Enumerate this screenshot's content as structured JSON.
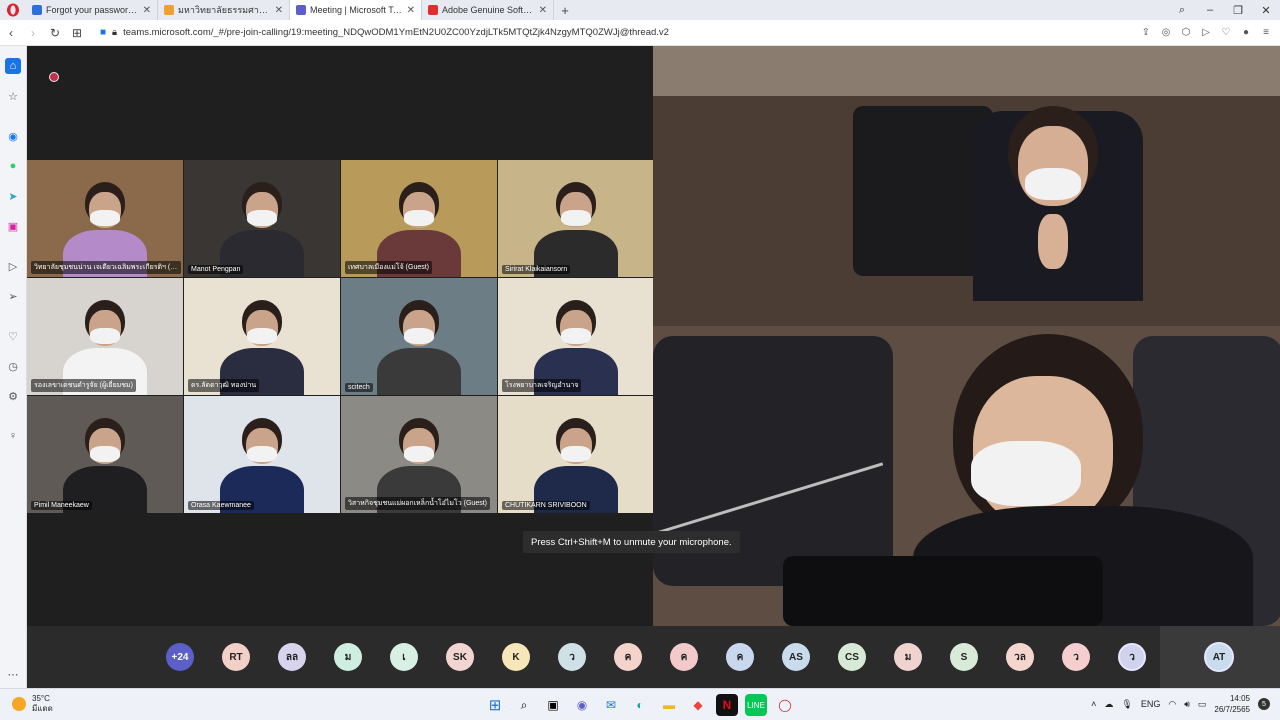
{
  "browser": {
    "tabs": [
      {
        "title": "Forgot your password? - Z",
        "color": "#2d6fdb",
        "active": false
      },
      {
        "title": "มหาวิทยาลัยธรรมศาสตร์",
        "color": "#f0a030",
        "active": false
      },
      {
        "title": "Meeting | Microsoft Tea",
        "color": "#5b5fc7",
        "active": true
      },
      {
        "title": "Adobe Genuine Software",
        "color": "#e02d2d",
        "active": false
      }
    ],
    "new_tab": "+",
    "url": "teams.microsoft.com/_#/pre-join-calling/19:meeting_NDQwODM1YmEtN2U0ZC00YzdjLTk5MTQtZjk4NzgyMTQ0ZWJj@thread.v2"
  },
  "meeting": {
    "tiles": [
      {
        "name": "วิทยาลัยชุมชนน่าน เจเดียวเฉลิมพระเกียรติฯ (Guest)",
        "bg": "#8a6a4a",
        "shirt": "#b48ac8"
      },
      {
        "name": "Manot Pengpan",
        "bg": "#3a3633",
        "shirt": "#2a2a30"
      },
      {
        "name": "เทศบาลเมืองแม่โจ้ (Guest)",
        "bg": "#b89a5a",
        "shirt": "#6a3a3a"
      },
      {
        "name": "Sirirat Klaikaiansorn",
        "bg": "#c7b489",
        "shirt": "#2b2b2b"
      },
      {
        "name": "รองเลขาเดชนดำรูจัย (ผู้เยี่ยมชม)",
        "bg": "#d7d3cf",
        "shirt": "#f3f3f3"
      },
      {
        "name": "ดร.ลัดดาวุฒิ ทองปาน",
        "bg": "#e9e2d2",
        "shirt": "#2a2c40"
      },
      {
        "name": "scitech",
        "bg": "#6c7d86",
        "shirt": "#3a3a3a"
      },
      {
        "name": "โรงพยาบาลเจริญอำนาจ",
        "bg": "#e8e0d0",
        "shirt": "#2a3050"
      },
      {
        "name": "Pimil Maneekaew",
        "bg": "#5f5a55",
        "shirt": "#1f1f22"
      },
      {
        "name": "Orasa Kaewmanee",
        "bg": "#dfe3ea",
        "shirt": "#1c2a5a"
      },
      {
        "name": "วิสาหกิจชุมชนแม่ผอกเหล็กน้ำโอ๋ไมโว (Guest)",
        "bg": "#8c8a85",
        "shirt": "#3a3a3a"
      },
      {
        "name": "CHUTIKARN SRIVIBOON",
        "bg": "#e6ddc8",
        "shirt": "#1f2a4a"
      }
    ],
    "toast": "Press Ctrl+Shift+M to unmute your microphone.",
    "participants": [
      {
        "initials": "+24",
        "color": "#5b5fc7"
      },
      {
        "initials": "RT",
        "color": "#f2cfc7"
      },
      {
        "initials": "ลล",
        "color": "#d8d4ee"
      },
      {
        "initials": "ม",
        "color": "#cdeee0"
      },
      {
        "initials": "เ",
        "color": "#d8efe4"
      },
      {
        "initials": "SK",
        "color": "#f2d4d0"
      },
      {
        "initials": "K",
        "color": "#f7e7b8"
      },
      {
        "initials": "ว",
        "color": "#cfe0e6"
      },
      {
        "initials": "ค",
        "color": "#f3d3cc"
      },
      {
        "initials": "ค",
        "color": "#f3c9c9"
      },
      {
        "initials": "ค",
        "color": "#c9d8ee"
      },
      {
        "initials": "AS",
        "color": "#c9dcee"
      },
      {
        "initials": "CS",
        "color": "#d6ead7"
      },
      {
        "initials": "ม",
        "color": "#f0d3ce"
      },
      {
        "initials": "S",
        "color": "#d8ead8"
      },
      {
        "initials": "วล",
        "color": "#f5d6cf"
      },
      {
        "initials": "ว",
        "color": "#f5cfcf"
      },
      {
        "initials": "ว",
        "color": "#cfd3ee"
      }
    ],
    "self_initials": "AT",
    "self_color": "#c9dcee"
  },
  "taskbar": {
    "temperature": "35°C",
    "condition": "มีแดด",
    "language": "ENG",
    "time": "14:05",
    "date": "26/7/2565",
    "notif": "5"
  }
}
